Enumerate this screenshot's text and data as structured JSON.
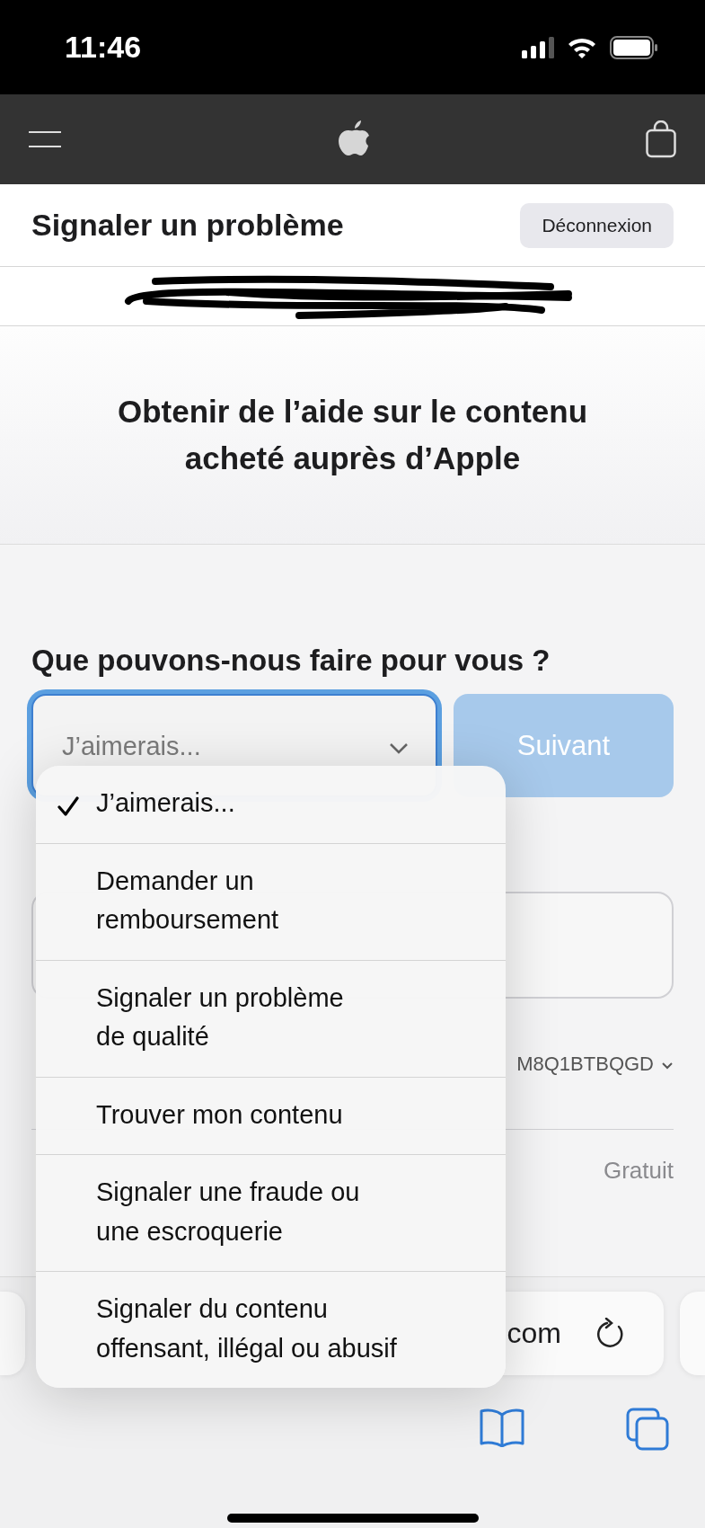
{
  "status_bar": {
    "time": "11:46"
  },
  "header": {
    "title": "Signaler un problème",
    "logout_button": "Déconnexion"
  },
  "hero": {
    "heading": "Obtenir de l’aide sur le contenu acheté auprès d’Apple"
  },
  "form": {
    "question": "Que pouvons-nous faire pour vous ?",
    "select": {
      "placeholder": "J’aimerais...",
      "focused": true
    },
    "next_button": {
      "label": "Suivant",
      "disabled": true
    }
  },
  "order": {
    "id": "M8Q1BTBQGD",
    "price": "Gratuit"
  },
  "browser": {
    "url": "com"
  },
  "dropdown": {
    "options": [
      {
        "label": "J’aimerais...",
        "selected": true
      },
      {
        "label": "Demander un\nremboursement",
        "selected": false
      },
      {
        "label": "Signaler un problème\nde qualité",
        "selected": false
      },
      {
        "label": "Trouver mon contenu",
        "selected": false
      },
      {
        "label": "Signaler une fraude ou\nune escroquerie",
        "selected": false
      },
      {
        "label": "Signaler du contenu\noffensant, illégal ou abusif",
        "selected": false
      }
    ]
  }
}
